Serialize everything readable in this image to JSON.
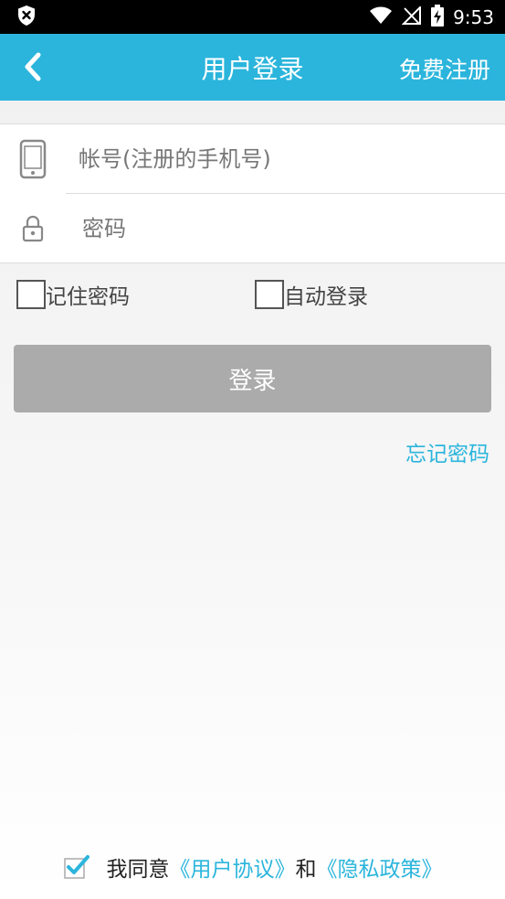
{
  "status_bar": {
    "time": "9:53"
  },
  "header": {
    "title": "用户登录",
    "register_label": "免费注册"
  },
  "form": {
    "account_placeholder": "帐号(注册的手机号)",
    "password_placeholder": "密码"
  },
  "options": {
    "remember_label": "记住密码",
    "auto_login_label": "自动登录"
  },
  "login_button": {
    "label": "登录"
  },
  "forgot_password": "忘记密码",
  "agreement": {
    "prefix": "我同意",
    "user_agreement": "《用户协议》",
    "and": "和",
    "privacy_policy": "《隐私政策》",
    "checked": true
  },
  "colors": {
    "accent": "#2bb5dc",
    "button_disabled": "#ababab"
  }
}
